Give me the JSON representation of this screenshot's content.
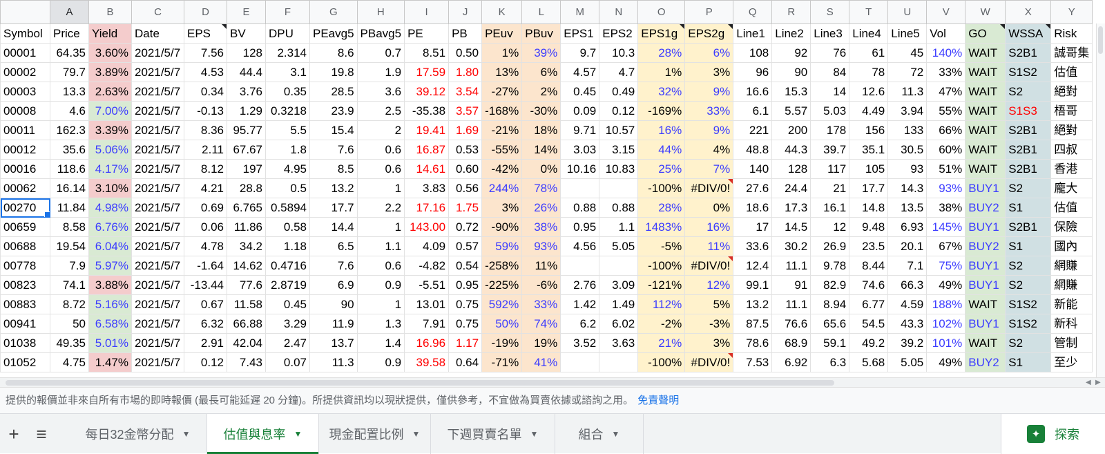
{
  "colors": {
    "red_fill": "#f4cccc",
    "green_fill": "#d9ead3",
    "orange_fill": "#fce5cd",
    "yellow_fill": "#fff2cc",
    "go_fill": "#d9ead3",
    "wssa_fill": "#d0e0e3",
    "text_red": "#ff0000",
    "text_blue": "#3c3cff",
    "active_tab": "#188038",
    "link": "#1a73e8"
  },
  "columns": [
    "A",
    "B",
    "C",
    "D",
    "E",
    "F",
    "G",
    "H",
    "I",
    "J",
    "K",
    "L",
    "M",
    "N",
    "O",
    "P",
    "Q",
    "R",
    "S",
    "T",
    "U",
    "V",
    "W",
    "X",
    "Y"
  ],
  "headers": [
    "Symbol",
    "Price",
    "Yield",
    "Date",
    "EPS",
    "BV",
    "DPU",
    "PEavg5",
    "PBavg5",
    "PE",
    "PB",
    "PEuv",
    "PBuv",
    "EPS1",
    "EPS2",
    "EPS1g",
    "EPS2g",
    "Line1",
    "Line2",
    "Line3",
    "Line4",
    "Line5",
    "Vol",
    "GO",
    "WSSA",
    "Risk"
  ],
  "rows": [
    [
      "00001",
      "64.35",
      "3.60%",
      "2021/5/7",
      "7.56",
      "128",
      "2.314",
      "8.6",
      "0.7",
      "8.51",
      "0.50",
      "1%",
      "39%",
      "9.7",
      "10.3",
      "28%",
      "6%",
      "108",
      "92",
      "76",
      "61",
      "45",
      "140%",
      "WAIT",
      "S2B1",
      "誠哥集"
    ],
    [
      "00002",
      "79.7",
      "3.89%",
      "2021/5/7",
      "4.53",
      "44.4",
      "3.1",
      "19.8",
      "1.9",
      "17.59",
      "1.80",
      "13%",
      "6%",
      "4.57",
      "4.7",
      "1%",
      "3%",
      "96",
      "90",
      "84",
      "78",
      "72",
      "33%",
      "WAIT",
      "S1S2",
      "估值"
    ],
    [
      "00003",
      "13.3",
      "2.63%",
      "2021/5/7",
      "0.34",
      "3.76",
      "0.35",
      "28.5",
      "3.6",
      "39.12",
      "3.54",
      "-27%",
      "2%",
      "0.45",
      "0.49",
      "32%",
      "9%",
      "16.6",
      "15.3",
      "14",
      "12.6",
      "11.3",
      "47%",
      "WAIT",
      "S2",
      "絕對"
    ],
    [
      "00008",
      "4.6",
      "7.00%",
      "2021/5/7",
      "-0.13",
      "1.29",
      "0.3218",
      "23.9",
      "2.5",
      "-35.38",
      "3.57",
      "-168%",
      "-30%",
      "0.09",
      "0.12",
      "-169%",
      "33%",
      "6.1",
      "5.57",
      "5.03",
      "4.49",
      "3.94",
      "55%",
      "WAIT",
      "S1S3",
      "梧哥"
    ],
    [
      "00011",
      "162.3",
      "3.39%",
      "2021/5/7",
      "8.36",
      "95.77",
      "5.5",
      "15.4",
      "2",
      "19.41",
      "1.69",
      "-21%",
      "18%",
      "9.71",
      "10.57",
      "16%",
      "9%",
      "221",
      "200",
      "178",
      "156",
      "133",
      "66%",
      "WAIT",
      "S2B1",
      "絕對"
    ],
    [
      "00012",
      "35.6",
      "5.06%",
      "2021/5/7",
      "2.11",
      "67.67",
      "1.8",
      "7.6",
      "0.6",
      "16.87",
      "0.53",
      "-55%",
      "14%",
      "3.03",
      "3.15",
      "44%",
      "4%",
      "48.8",
      "44.3",
      "39.7",
      "35.1",
      "30.5",
      "60%",
      "WAIT",
      "S2B1",
      "四叔"
    ],
    [
      "00016",
      "118.6",
      "4.17%",
      "2021/5/7",
      "8.12",
      "197",
      "4.95",
      "8.5",
      "0.6",
      "14.61",
      "0.60",
      "-42%",
      "0%",
      "10.16",
      "10.83",
      "25%",
      "7%",
      "140",
      "128",
      "117",
      "105",
      "93",
      "51%",
      "WAIT",
      "S2B1",
      "香港"
    ],
    [
      "00062",
      "16.14",
      "3.10%",
      "2021/5/7",
      "4.21",
      "28.8",
      "0.5",
      "13.2",
      "1",
      "3.83",
      "0.56",
      "244%",
      "78%",
      "",
      "",
      "-100%",
      "#DIV/0!",
      "27.6",
      "24.4",
      "21",
      "17.7",
      "14.3",
      "93%",
      "BUY1",
      "S2",
      "龐大"
    ],
    [
      "00270",
      "11.84",
      "4.98%",
      "2021/5/7",
      "0.69",
      "6.765",
      "0.5894",
      "17.7",
      "2.2",
      "17.16",
      "1.75",
      "3%",
      "26%",
      "0.88",
      "0.88",
      "28%",
      "0%",
      "18.6",
      "17.3",
      "16.1",
      "14.8",
      "13.5",
      "38%",
      "BUY2",
      "S1",
      "估值"
    ],
    [
      "00659",
      "8.58",
      "6.76%",
      "2021/5/7",
      "0.06",
      "11.86",
      "0.58",
      "14.4",
      "1",
      "143.00",
      "0.72",
      "-90%",
      "38%",
      "0.95",
      "1.1",
      "1483%",
      "16%",
      "17",
      "14.5",
      "12",
      "9.48",
      "6.93",
      "145%",
      "BUY1",
      "S2B1",
      "保險"
    ],
    [
      "00688",
      "19.54",
      "6.04%",
      "2021/5/7",
      "4.78",
      "34.2",
      "1.18",
      "6.5",
      "1.1",
      "4.09",
      "0.57",
      "59%",
      "93%",
      "4.56",
      "5.05",
      "-5%",
      "11%",
      "33.6",
      "30.2",
      "26.9",
      "23.5",
      "20.1",
      "67%",
      "BUY2",
      "S1",
      "國內"
    ],
    [
      "00778",
      "7.9",
      "5.97%",
      "2021/5/7",
      "-1.64",
      "14.62",
      "0.4716",
      "7.6",
      "0.6",
      "-4.82",
      "0.54",
      "-258%",
      "11%",
      "",
      "",
      "-100%",
      "#DIV/0!",
      "12.4",
      "11.1",
      "9.78",
      "8.44",
      "7.1",
      "75%",
      "BUY1",
      "S2",
      "網賺"
    ],
    [
      "00823",
      "74.1",
      "3.88%",
      "2021/5/7",
      "-13.44",
      "77.6",
      "2.8719",
      "6.9",
      "0.9",
      "-5.51",
      "0.95",
      "-225%",
      "-6%",
      "2.76",
      "3.09",
      "-121%",
      "12%",
      "99.1",
      "91",
      "82.9",
      "74.6",
      "66.3",
      "49%",
      "BUY1",
      "S2",
      "網賺"
    ],
    [
      "00883",
      "8.72",
      "5.16%",
      "2021/5/7",
      "0.67",
      "11.58",
      "0.45",
      "90",
      "1",
      "13.01",
      "0.75",
      "592%",
      "33%",
      "1.42",
      "1.49",
      "112%",
      "5%",
      "13.2",
      "11.1",
      "8.94",
      "6.77",
      "4.59",
      "188%",
      "WAIT",
      "S1S2",
      "新能"
    ],
    [
      "00941",
      "50",
      "6.58%",
      "2021/5/7",
      "6.32",
      "66.88",
      "3.29",
      "11.9",
      "1.3",
      "7.91",
      "0.75",
      "50%",
      "74%",
      "6.2",
      "6.02",
      "-2%",
      "-3%",
      "87.5",
      "76.6",
      "65.6",
      "54.5",
      "43.3",
      "102%",
      "BUY1",
      "S1S2",
      "新科"
    ],
    [
      "01038",
      "49.35",
      "5.01%",
      "2021/5/7",
      "2.91",
      "42.04",
      "2.47",
      "13.7",
      "1.4",
      "16.96",
      "1.17",
      "-19%",
      "19%",
      "3.52",
      "3.63",
      "21%",
      "3%",
      "78.6",
      "68.9",
      "59.1",
      "49.2",
      "39.2",
      "101%",
      "WAIT",
      "S2",
      "管制"
    ],
    [
      "01052",
      "4.75",
      "1.47%",
      "2021/5/7",
      "0.12",
      "7.43",
      "0.07",
      "11.3",
      "0.9",
      "39.58",
      "0.64",
      "-71%",
      "41%",
      "",
      "",
      "-100%",
      "#DIV/0!",
      "7.53",
      "6.92",
      "6.3",
      "5.68",
      "5.05",
      "49%",
      "BUY2",
      "S1",
      "至少"
    ]
  ],
  "active_cell": "A9",
  "disclaimer": {
    "text": "提供的報價並非來自所有市場的即時報價 (最長可能延遲 20 分鐘)。所提供資訊均以現狀提供，僅供參考，不宜做為買賣依據或諮詢之用。",
    "link": "免責聲明"
  },
  "sheet_bar": {
    "add_icon": "+",
    "list_icon": "≡",
    "tabs": [
      "每日32金幣分配",
      "估值與息率",
      "現金配置比例",
      "下週買賣名單",
      "組合"
    ],
    "active_tab_index": 1,
    "explore_label": "探索"
  }
}
